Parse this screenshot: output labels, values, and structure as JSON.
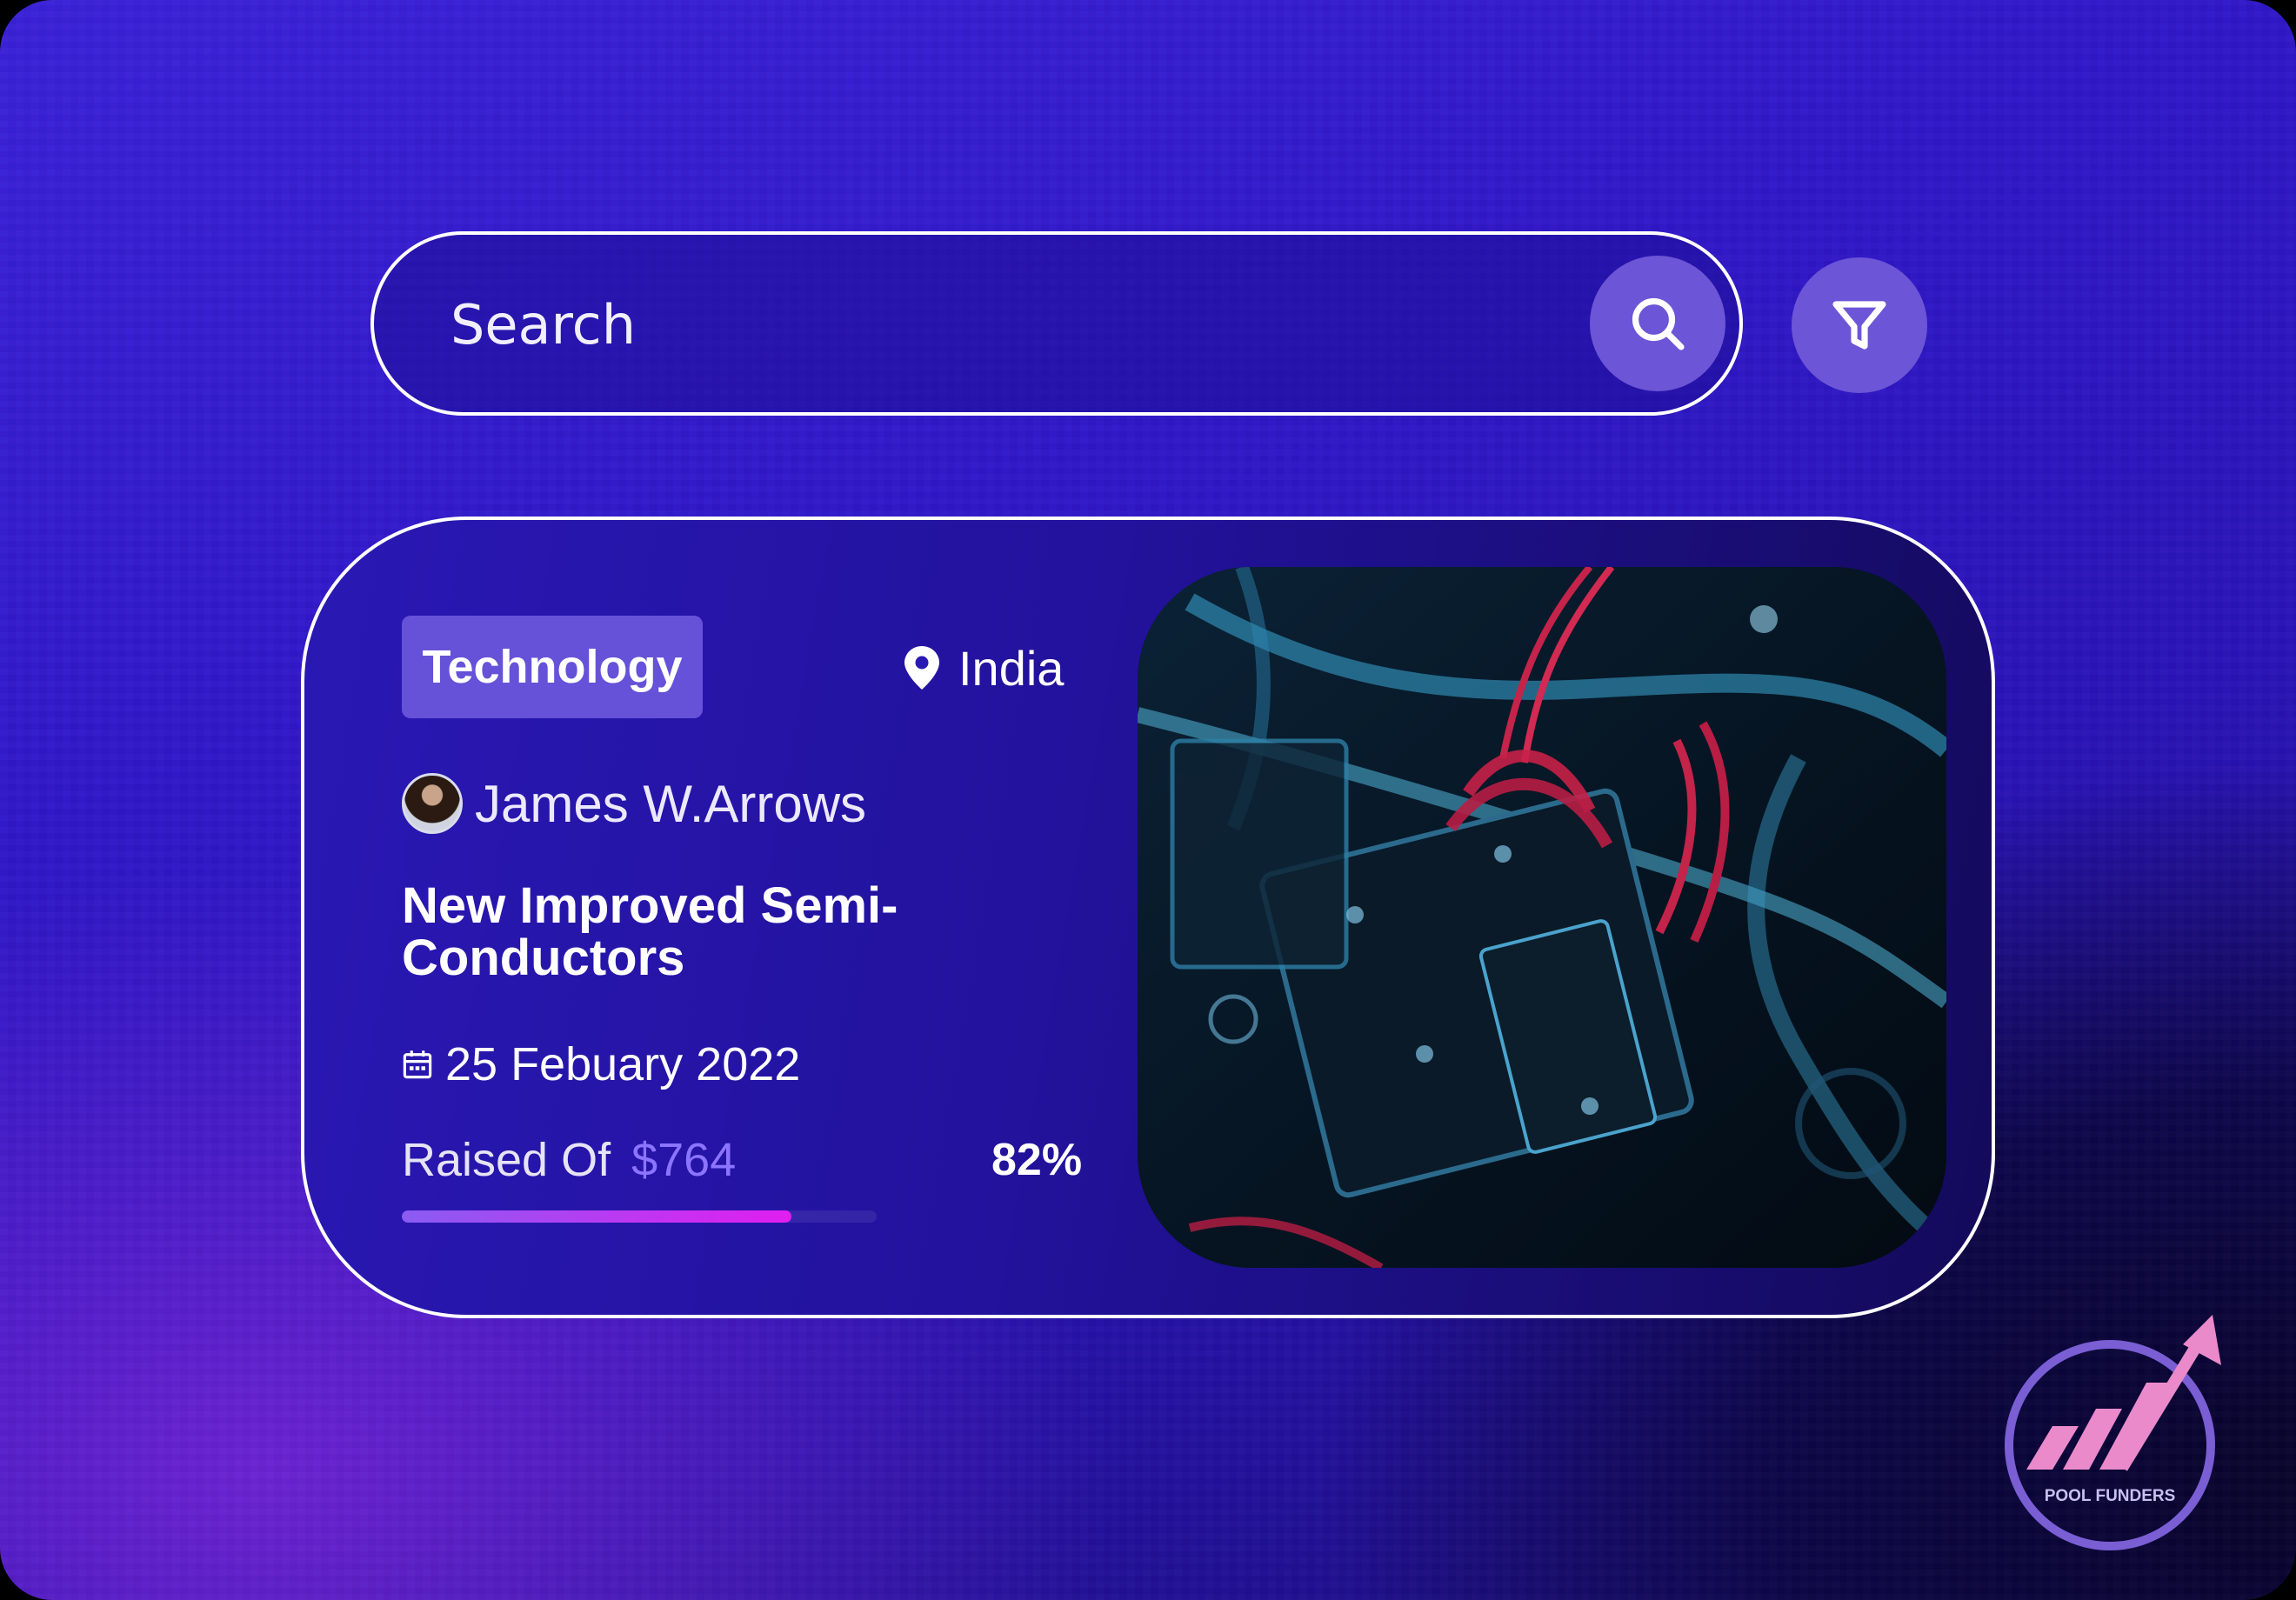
{
  "search": {
    "placeholder": "Search",
    "search_button_icon": "search-icon",
    "filter_button_icon": "filter-icon"
  },
  "card": {
    "category": "Technology",
    "location": "India",
    "location_icon": "map-pin-icon",
    "author": "James W.Arrows",
    "title": "New Improved Semi-Conductors",
    "date_icon": "calendar-icon",
    "date": "25 Febuary 2022",
    "raised_label": "Raised Of",
    "raised_amount": "$764",
    "percent_label": "82%",
    "progress_fraction": 0.82
  },
  "logo": {
    "text": "POOL FUNDERS"
  },
  "colors": {
    "accent": "#6c55d6",
    "badge": "#6652d8",
    "amount": "#8b74ff",
    "progress_start": "#8a5cf2",
    "progress_end": "#e11ef0",
    "logo_pink": "#ea8acb"
  }
}
